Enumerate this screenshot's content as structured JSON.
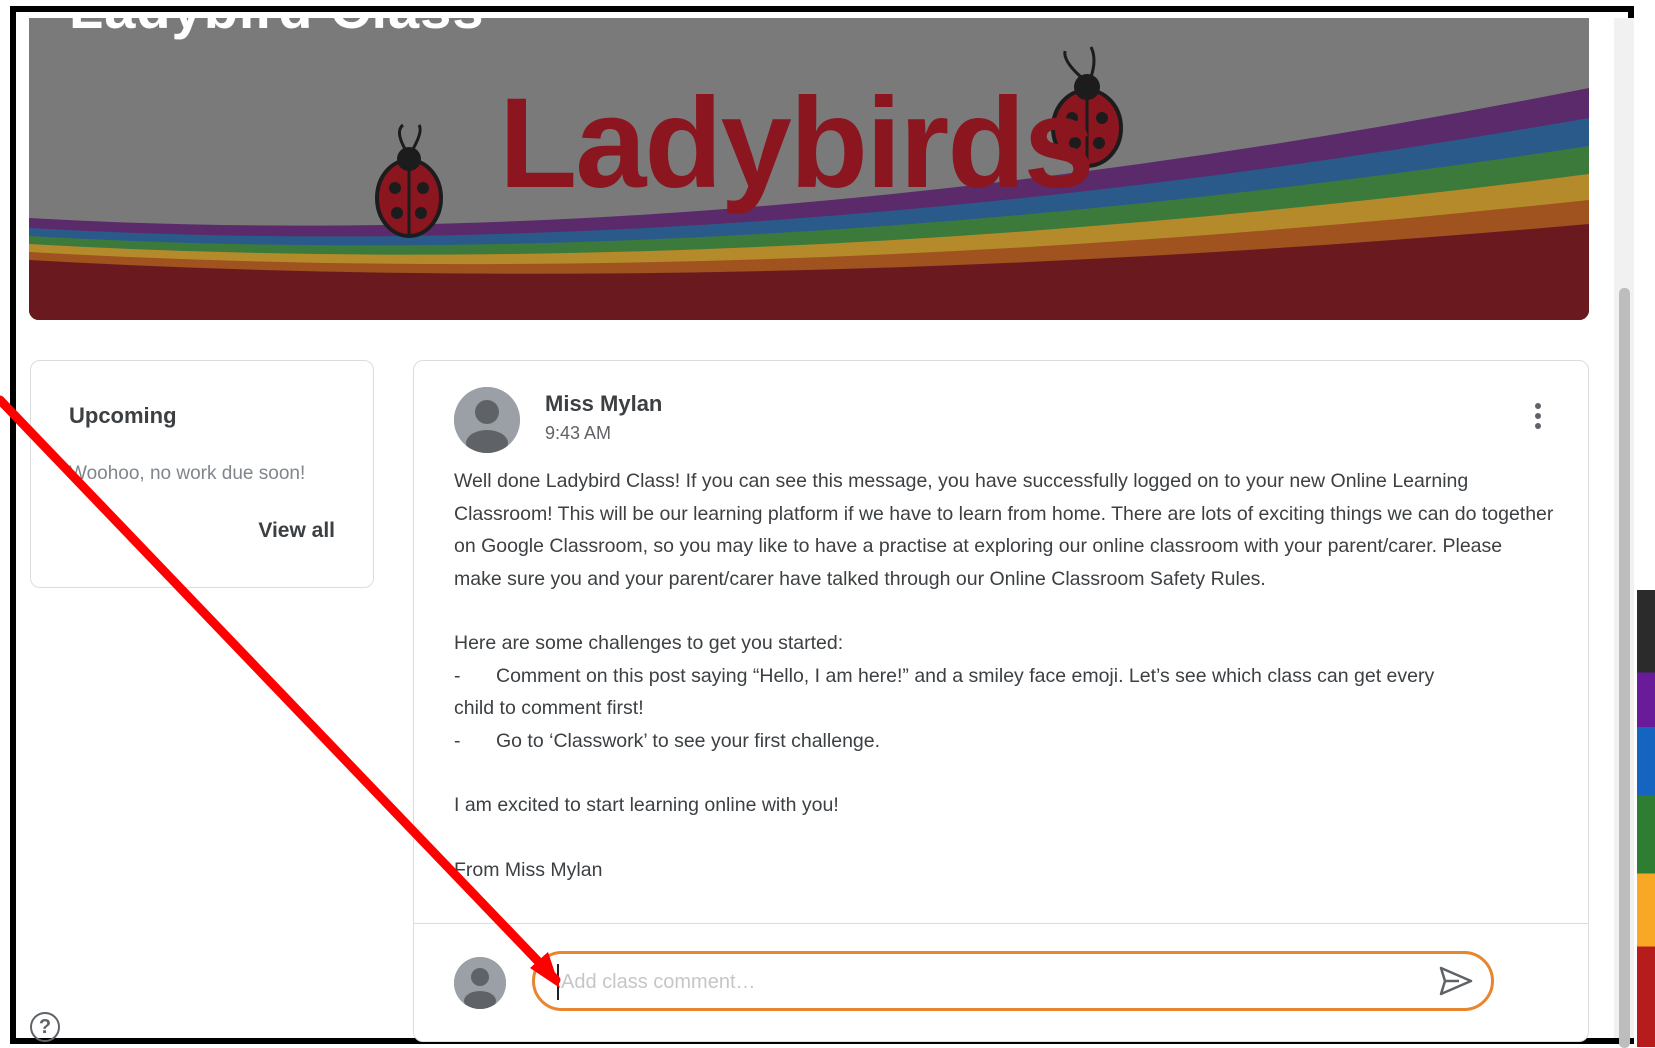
{
  "banner": {
    "class_name": "Ladybird Class",
    "art_word": "Ladybirds"
  },
  "upcoming": {
    "title": "Upcoming",
    "empty_text": "Woohoo, no work due soon!",
    "view_all": "View all"
  },
  "post": {
    "author": "Miss Mylan",
    "time": "9:43 AM",
    "paragraph1": "Well done Ladybird Class! If you can see this message, you have successfully logged on to your new Online Learning Classroom! This will be our learning platform if we have to learn from home. There are lots of exciting things we can do together on Google Classroom, so you may like to have a practise at exploring our online classroom with your parent/carer. Please make sure you and your parent/carer have talked through our Online Classroom Safety Rules.",
    "challenges_intro": "Here are some challenges to get you started:",
    "challenges": [
      {
        "dash": "-",
        "text": "Comment on this post saying “Hello, I am here!” and a smiley face emoji. Let’s see which class can get every"
      },
      {
        "dash": "",
        "text": "child to comment first!"
      },
      {
        "dash": "-",
        "text": "Go to ‘Classwork’ to see your first challenge."
      }
    ],
    "closing": "I am excited to start learning online with you!",
    "signoff": "From Miss Mylan"
  },
  "comment": {
    "placeholder": "Add class comment…",
    "value": ""
  },
  "icons": {
    "help": "help-icon",
    "send": "send-icon",
    "more": "more-vert-icon",
    "avatar": "avatar-icon"
  },
  "colors": {
    "banner_red": "#8b1620",
    "comment_border": "#e8852e",
    "annotation_arrow": "#ff0000",
    "frame": "#000000"
  }
}
